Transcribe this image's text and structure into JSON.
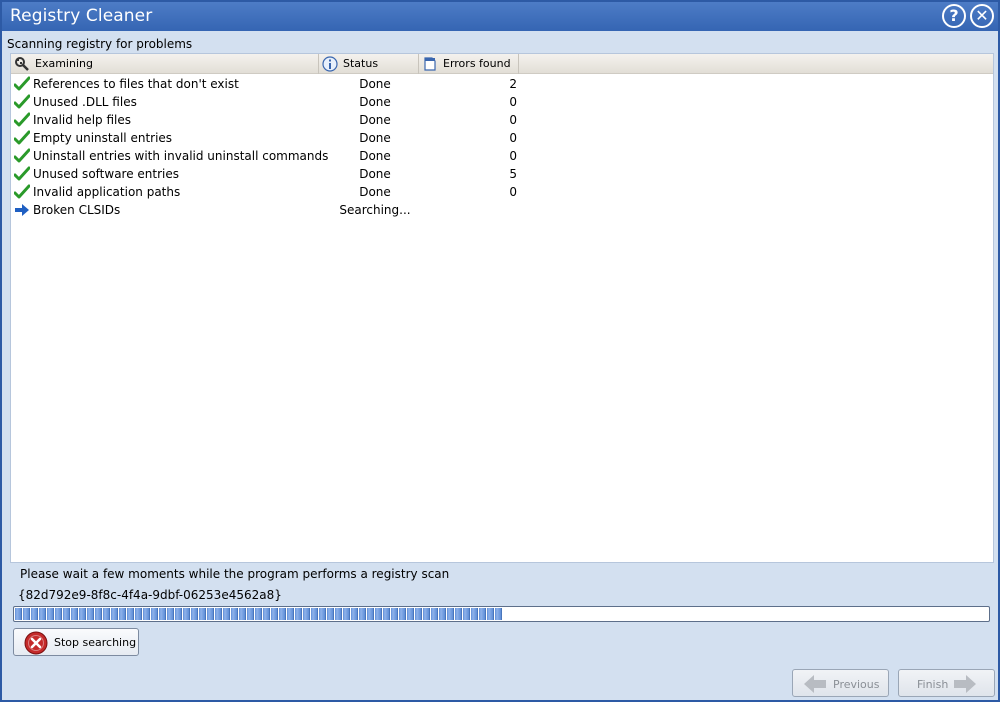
{
  "window": {
    "title": "Registry Cleaner",
    "help_glyph": "?",
    "close_glyph": "✕"
  },
  "heading": "Scanning registry for problems",
  "table": {
    "columns": [
      "Examining",
      "Status",
      "Errors found"
    ],
    "rows": [
      {
        "icon": "checkmark-icon",
        "name": "References to files that don't exist",
        "status": "Done",
        "errors": "2"
      },
      {
        "icon": "checkmark-icon",
        "name": "Unused .DLL files",
        "status": "Done",
        "errors": "0"
      },
      {
        "icon": "checkmark-icon",
        "name": "Invalid help files",
        "status": "Done",
        "errors": "0"
      },
      {
        "icon": "checkmark-icon",
        "name": "Empty uninstall entries",
        "status": "Done",
        "errors": "0"
      },
      {
        "icon": "checkmark-icon",
        "name": "Uninstall entries with invalid uninstall commands",
        "status": "Done",
        "errors": "0"
      },
      {
        "icon": "checkmark-icon",
        "name": "Unused software entries",
        "status": "Done",
        "errors": "5"
      },
      {
        "icon": "checkmark-icon",
        "name": "Invalid application paths",
        "status": "Done",
        "errors": "0"
      },
      {
        "icon": "arrow-right-icon",
        "name": "Broken CLSIDs",
        "status": "Searching...",
        "errors": ""
      }
    ]
  },
  "wait_message": "Please wait a few moments while the program performs a registry scan",
  "current_key": "{82d792e9-8f8c-4f4a-9dbf-06253e4562a8}",
  "progress": 0.5,
  "buttons": {
    "stop": "Stop searching",
    "previous": "Previous",
    "finish": "Finish"
  },
  "colors": {
    "titlebar": "#3a66ae",
    "background": "#d3e0f0",
    "check": "#2a9a2a",
    "arrow": "#1f5fc2"
  }
}
